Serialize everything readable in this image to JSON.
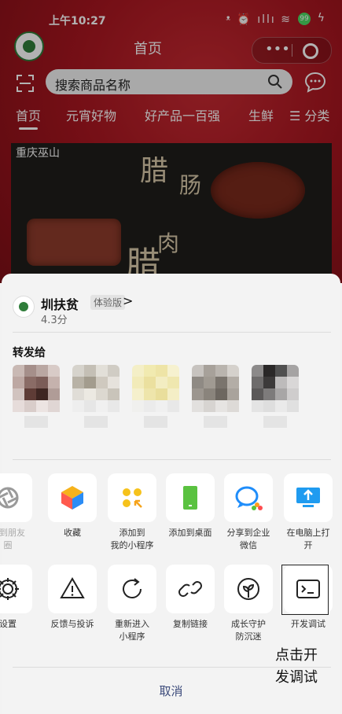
{
  "status_bar": {
    "time": "上午10:27",
    "icons": "ᵜ ⏰ ıllı ≋",
    "battery": "99",
    "bolt": "ϟ"
  },
  "header": {
    "title": "首页",
    "search_placeholder": "搜索商品名称"
  },
  "tabs": [
    {
      "label": "首页"
    },
    {
      "label": "元宵好物"
    },
    {
      "label": "好产品一百强"
    },
    {
      "label": "生鲜"
    },
    {
      "label": "☰ 分类"
    }
  ],
  "banner": {
    "caption": "重庆巫山",
    "word1": "腊",
    "word2": "肠",
    "word3": "腊",
    "word4": "肉"
  },
  "sheet": {
    "app_name": "圳扶贫",
    "app_badge": "体验版",
    "app_arrow": ">",
    "app_score": "4.3分",
    "share_title": "转发给",
    "actions_row1": [
      {
        "label": "享到朋友\n圈",
        "icon": "camera-icon"
      },
      {
        "label": "收藏",
        "icon": "cube-icon"
      },
      {
        "label": "添加到\n我的小程序",
        "icon": "dots-icon"
      },
      {
        "label": "添加到桌面",
        "icon": "phone-icon"
      },
      {
        "label": "分享到企业\n微信",
        "icon": "wechat-work-icon"
      },
      {
        "label": "在电脑上打\n开",
        "icon": "monitor-icon"
      }
    ],
    "actions_row2": [
      {
        "label": "设置",
        "icon": "gear-icon"
      },
      {
        "label": "反馈与投诉",
        "icon": "warning-icon"
      },
      {
        "label": "重新进入\n小程序",
        "icon": "refresh-icon"
      },
      {
        "label": "复制链接",
        "icon": "link-icon"
      },
      {
        "label": "成长守护\n防沉迷",
        "icon": "sprout-icon"
      },
      {
        "label": "开发调试",
        "icon": "terminal-icon"
      }
    ],
    "cancel": "取消"
  },
  "hint": "点击开\n发调试",
  "colors": {
    "brand_red": "#a81620",
    "accent_blue": "#3b4a7a"
  }
}
